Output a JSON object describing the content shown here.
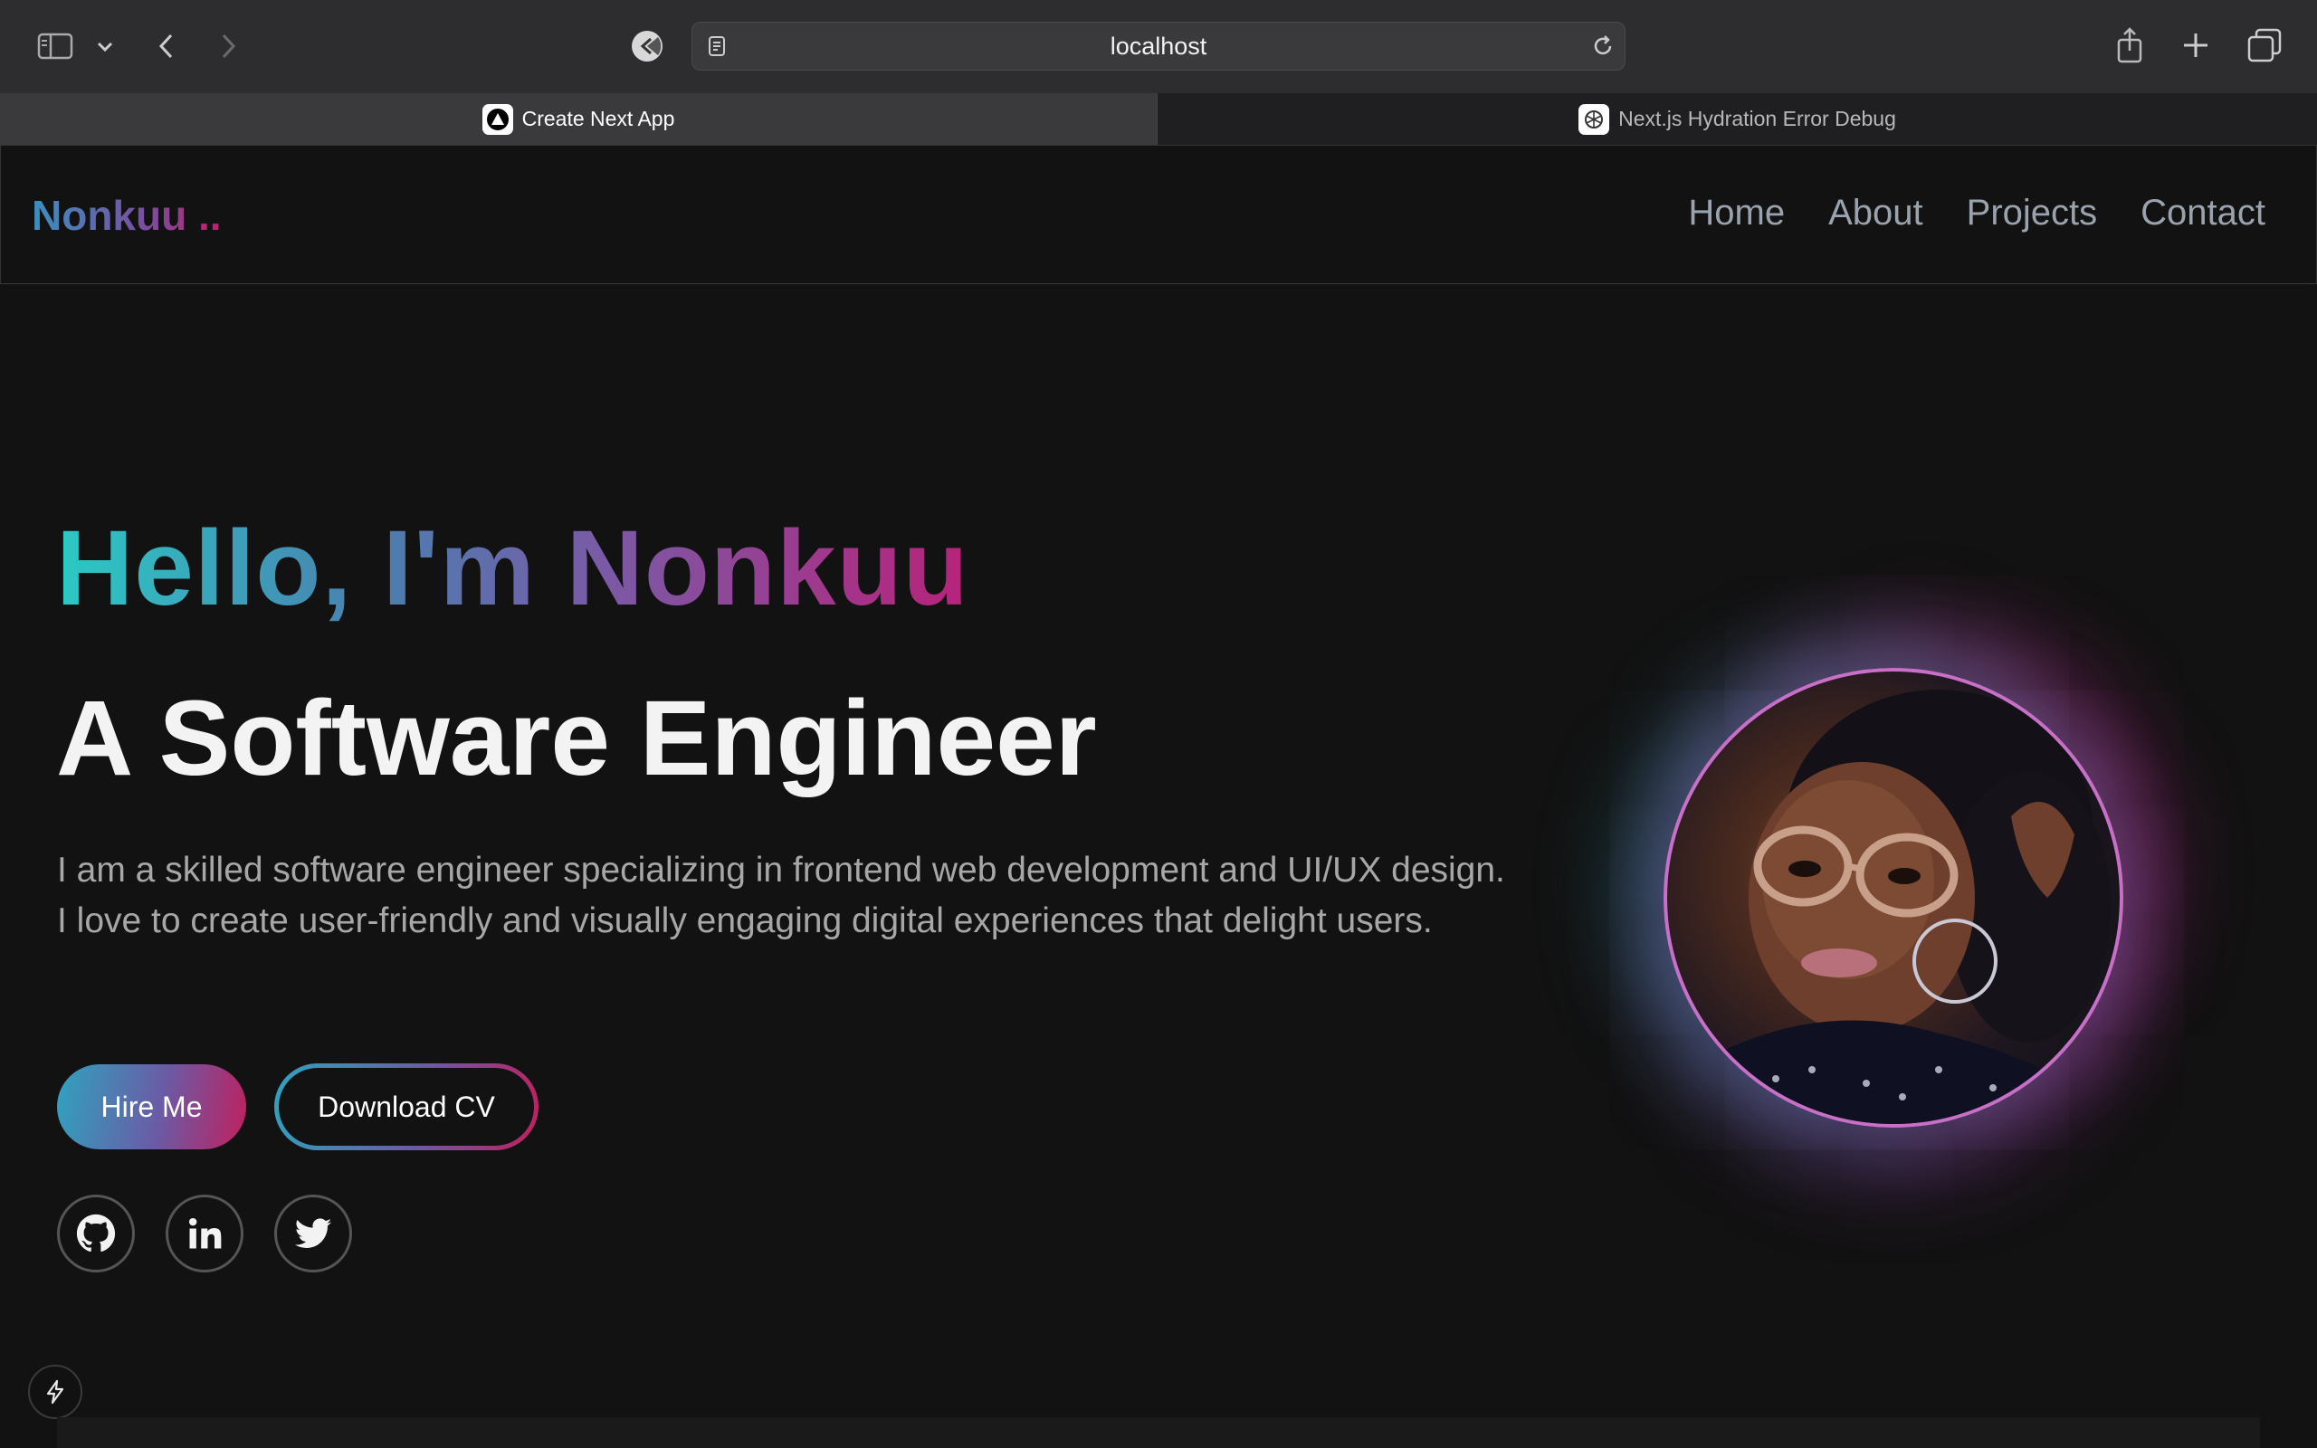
{
  "browser": {
    "url": "localhost",
    "tabs": [
      {
        "title": "Create Next App",
        "active": true
      },
      {
        "title": "Next.js Hydration Error Debug",
        "active": false
      }
    ],
    "icons": [
      "sidebar-icon",
      "chevron-down-icon",
      "back-icon",
      "forward-icon",
      "extension-icon",
      "reader-icon",
      "reload-icon",
      "share-icon",
      "new-tab-icon",
      "tab-overview-icon"
    ]
  },
  "nav": {
    "logo": "Nonkuu ..",
    "links": [
      "Home",
      "About",
      "Projects",
      "Contact"
    ]
  },
  "hero": {
    "greeting": "Hello, I'm Nonkuu",
    "role": "A Software Engineer",
    "bio": "I am a skilled software engineer specializing in frontend web development and UI/UX design. I love to create user-friendly and visually engaging digital experiences that delight users.",
    "hire_label": "Hire Me",
    "cv_label": "Download CV",
    "socials": [
      "github-icon",
      "linkedin-icon",
      "twitter-icon"
    ]
  },
  "colors": {
    "background": "#121212",
    "gradient_start": "#2cc9c5",
    "gradient_mid": "#7a5aa6",
    "gradient_end": "#b8227a",
    "nav_link": "#9aa3ad"
  }
}
